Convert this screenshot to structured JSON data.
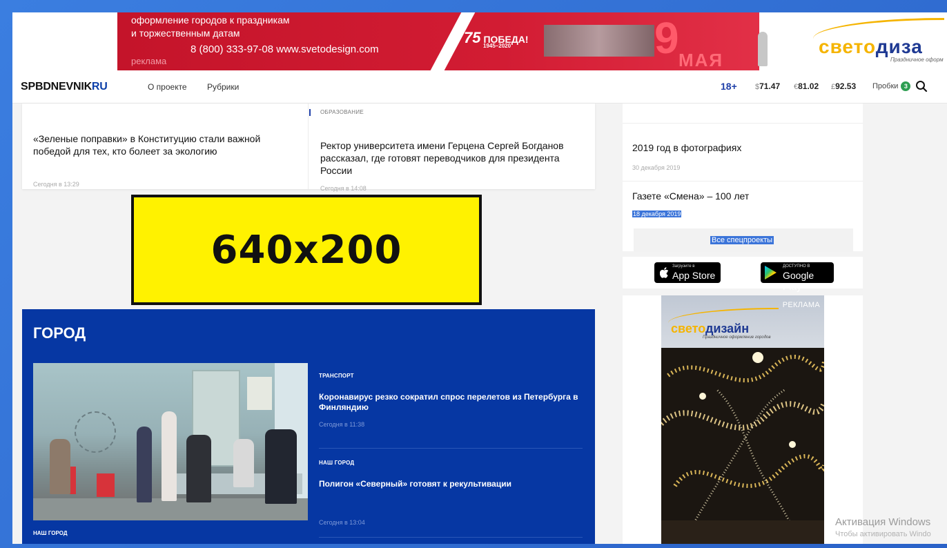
{
  "top_banner": {
    "line1": "оформление городов к праздникам",
    "line2": "и торжественным датам",
    "phone_url": "8 (800) 333-97-08 www.svetodesign.com",
    "ad_label": "реклама",
    "pobeda_num": "75",
    "pobeda_word": "ПОБЕДА!",
    "pobeda_years": "1945–2020",
    "day": "9",
    "month": "МАЯ",
    "logo_part1": "свето",
    "logo_part2": "диза",
    "logo_sub": "Праздничное оформ"
  },
  "navbar": {
    "logo_main": "SPB",
    "logo_mid": "DNEVNIK",
    "logo_ru": "RU",
    "links": [
      "О проекте",
      "Рубрики"
    ],
    "age": "18+",
    "rates": [
      {
        "symbol": "$",
        "value": "71.47"
      },
      {
        "symbol": "€",
        "value": "81.02"
      },
      {
        "symbol": "£",
        "value": "92.53"
      }
    ],
    "traffic_label": "Пробки",
    "traffic_level": "3"
  },
  "news": [
    {
      "category": "",
      "title": "«Зеленые поправки» в Конституцию стали важной победой для тех, кто болеет за экологию",
      "time": "Сегодня в 13:29"
    },
    {
      "category": "ОБРАЗОВАНИЕ",
      "title": "Ректор университета имени Герцена Сергей Богданов рассказал, где готовят переводчиков для президента России",
      "time": "Сегодня в 14:08"
    }
  ],
  "ad_placeholder": "640x200",
  "gorod": {
    "title": "ГОРОД",
    "photo_category": "НАШ ГОРОД",
    "items": [
      {
        "category": "ТРАНСПОРТ",
        "title": "Коронавирус резко сократил спрос перелетов из Петербурга в Финляндию",
        "time": "Сегодня в 11:38"
      },
      {
        "category": "НАШ ГОРОД",
        "title": "Полигон «Северный» готовят к рекультивации",
        "time": "Сегодня в 13:04"
      }
    ]
  },
  "sidebar": {
    "projects": [
      {
        "title": "2019 год в фотографиях",
        "date": "30 декабря 2019"
      },
      {
        "title": "Газете «Смена» – 100 лет",
        "date": "18 декабря 2019"
      }
    ],
    "all_projects_button": "Все спецпроекты",
    "app_store": {
      "small": "Загрузите в",
      "large": "App Store"
    },
    "google_play": {
      "small": "ДОСТУПНО В",
      "large": "Google Play"
    },
    "ad_label": "РЕКЛАМА",
    "ad_logo_part1": "свето",
    "ad_logo_part2": "дизайн",
    "ad_logo_sub": "Праздничное оформление городов"
  },
  "os_watermark": {
    "line1": "Активация Windows",
    "line2": "Чтобы активировать Windo"
  },
  "colors": {
    "frame": "#2f6fd0",
    "brand_blue": "#0637a3",
    "banner_red": "#d21c33",
    "ad_yellow": "#fff200",
    "traffic_green": "#2e9e52"
  }
}
